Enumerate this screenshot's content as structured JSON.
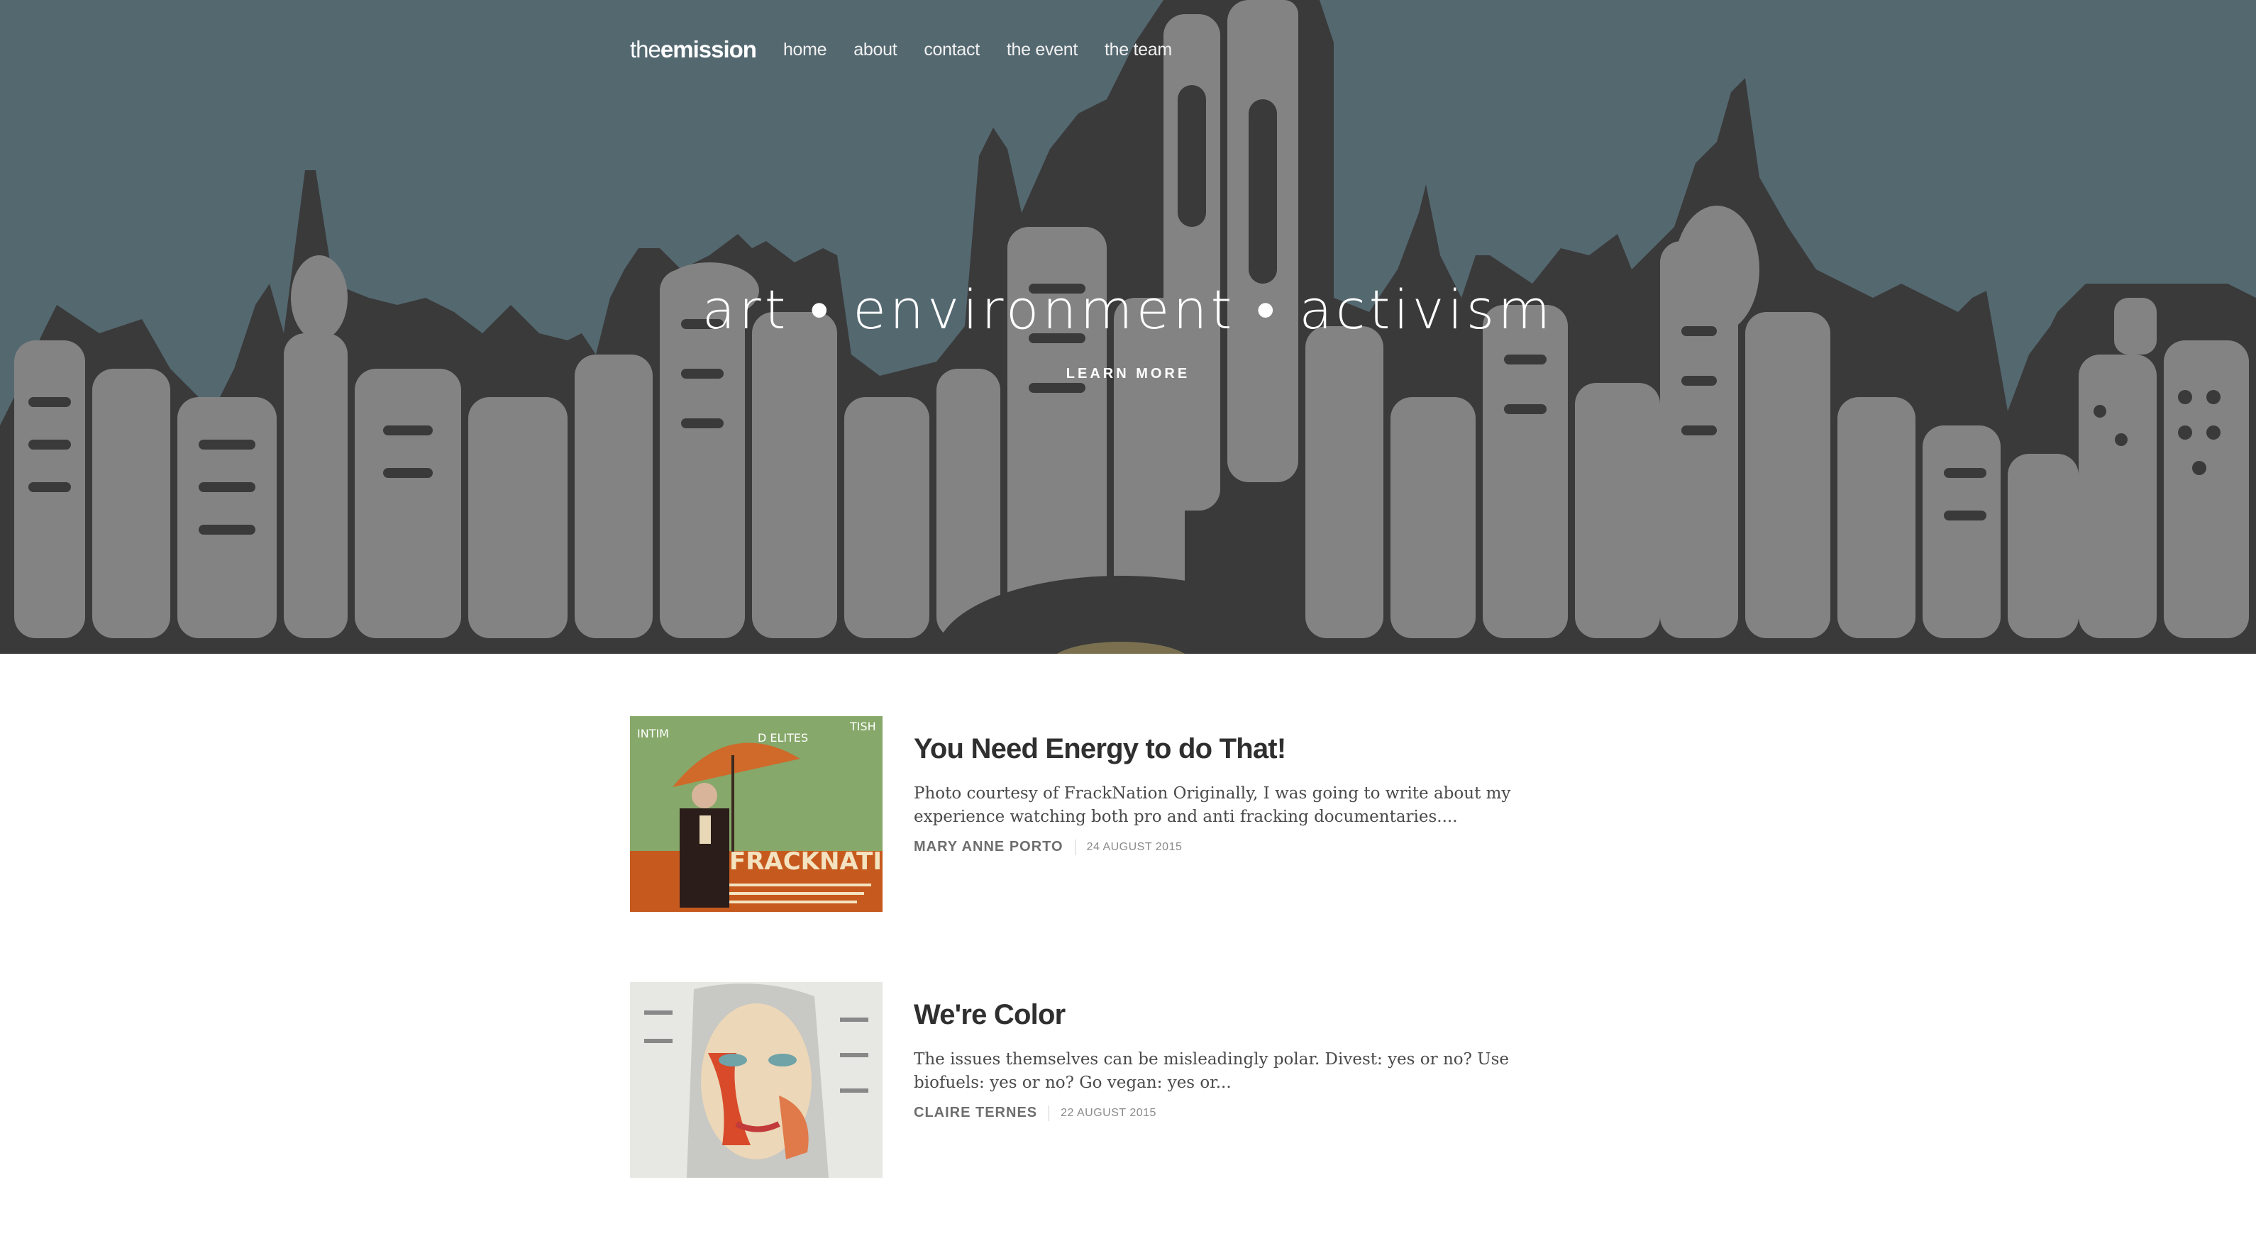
{
  "nav": {
    "brand_light": "the",
    "brand_bold": "emission",
    "items": [
      {
        "label": "home"
      },
      {
        "label": "about"
      },
      {
        "label": "contact"
      },
      {
        "label": "the event"
      },
      {
        "label": "the team"
      }
    ]
  },
  "hero": {
    "tagline": "art • environment • activism",
    "cta": "LEARN MORE",
    "background_color": "#546870",
    "skyline_color": "#838383",
    "outline_color": "#3a3a3a"
  },
  "posts": [
    {
      "title": "You Need Energy to do That!",
      "excerpt": "Photo courtesy of FrackNation Originally, I was going to write about my experience watching both pro and anti fracking documentaries....",
      "author": "MARY ANNE PORTO",
      "date": "24 AUGUST 2015",
      "thumb": {
        "poster_title": "FRACKNATION",
        "arc_left": "INTIM",
        "arc_mid": "D ELITES",
        "arc_right": "TISH"
      }
    },
    {
      "title": "We're Color",
      "excerpt": "The issues themselves can be misleadingly polar. Divest: yes or no? Use biofuels: yes or no? Go vegan: yes or...",
      "author": "CLAIRE TERNES",
      "date": "22 AUGUST 2015"
    }
  ]
}
